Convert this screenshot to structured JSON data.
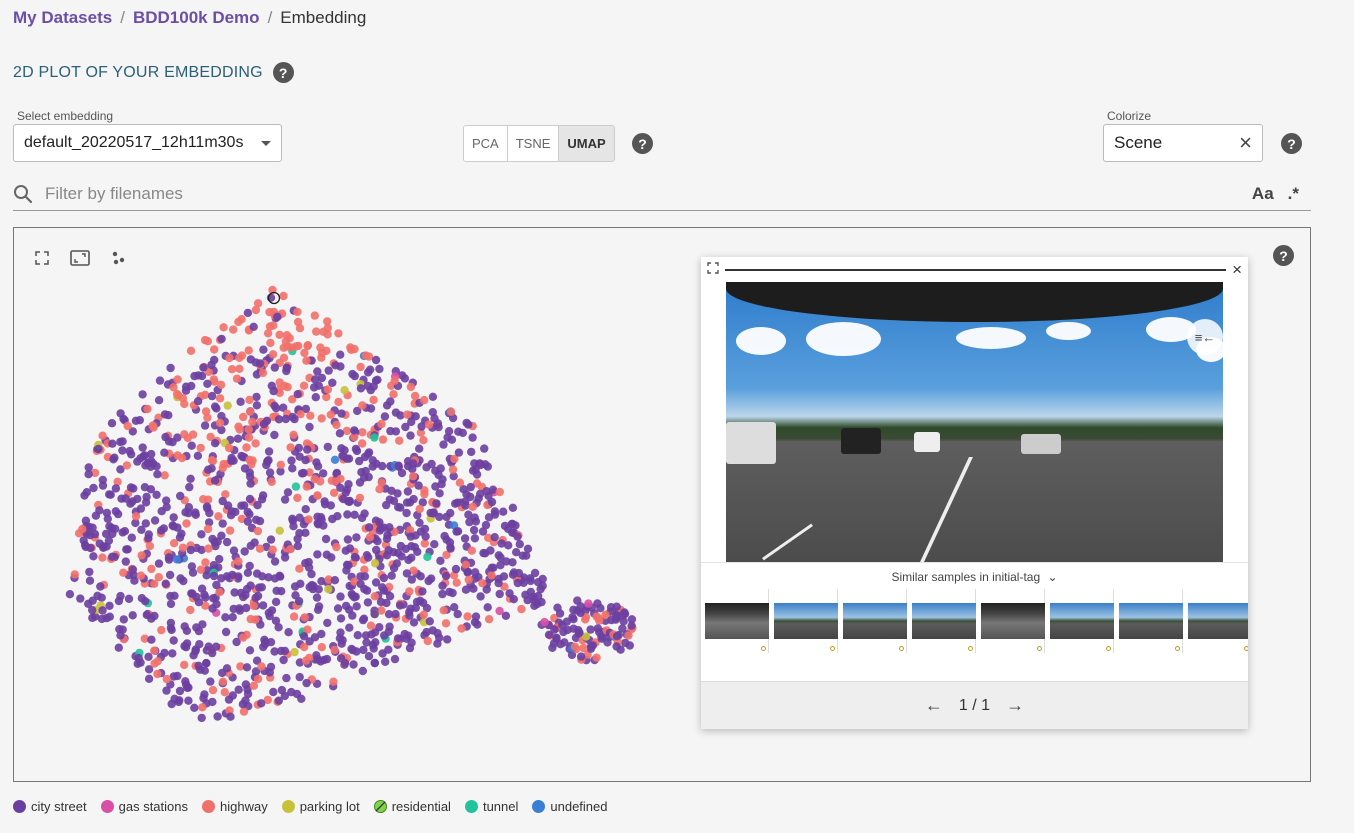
{
  "breadcrumb": {
    "items": [
      "My Datasets",
      "BDD100k Demo"
    ],
    "current": "Embedding",
    "separator": "/"
  },
  "section_title": "2D PLOT OF YOUR EMBEDDING",
  "embedding_select": {
    "label": "Select embedding",
    "value": "default_20220517_12h11m30s"
  },
  "projection": {
    "options": [
      "PCA",
      "TSNE",
      "UMAP"
    ],
    "selected": "UMAP"
  },
  "colorize": {
    "label": "Colorize",
    "value": "Scene"
  },
  "filter": {
    "placeholder": "Filter by filenames",
    "case_label": "Aa",
    "regex_label": ".*"
  },
  "help_symbol": "?",
  "popup": {
    "similar_label": "Similar samples in initial-tag",
    "pager": "1 / 1",
    "prev_symbol": "←",
    "next_symbol": "→",
    "close_symbol": "×"
  },
  "legend": [
    {
      "label": "city street",
      "color": "#6b3fa0"
    },
    {
      "label": "gas stations",
      "color": "#d94fa6"
    },
    {
      "label": "highway",
      "color": "#f2706a"
    },
    {
      "label": "parking lot",
      "color": "#c8c23a"
    },
    {
      "label": "residential",
      "color": "#7fd44a"
    },
    {
      "label": "tunnel",
      "color": "#22c39a"
    },
    {
      "label": "undefined",
      "color": "#3a7fd6"
    }
  ]
}
